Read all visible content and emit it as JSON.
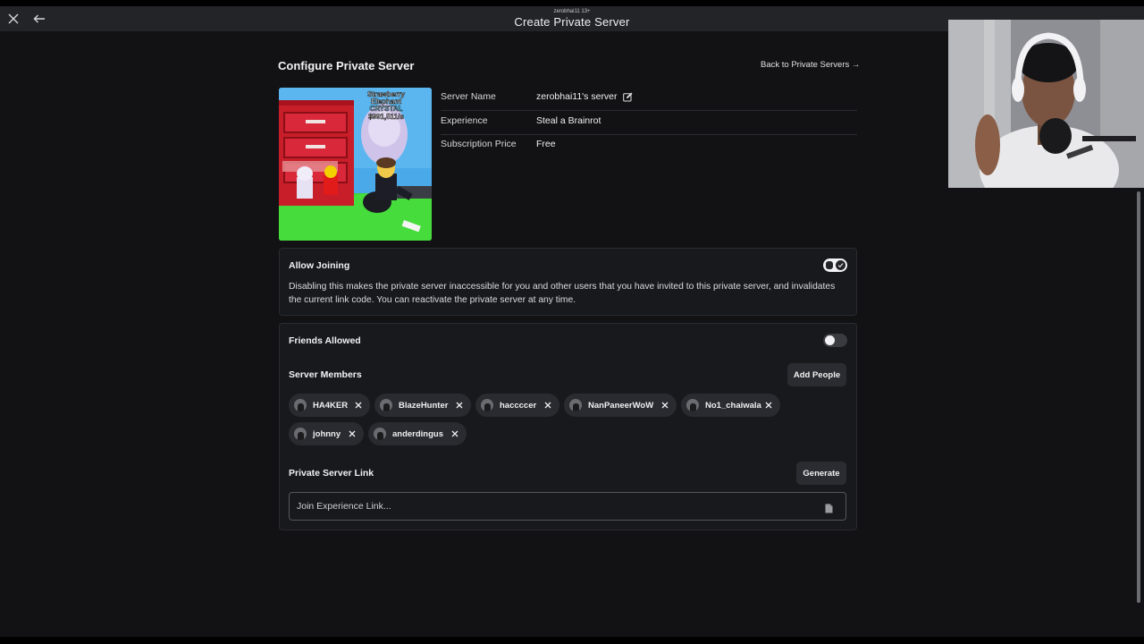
{
  "window": {
    "username": "zerobhai11 13+",
    "title": "Create Private Server"
  },
  "header": {
    "title": "Configure Private Server",
    "back_link": "Back to Private Servers →"
  },
  "details": {
    "server_name_label": "Server Name",
    "server_name_value": "zerobhai11's server",
    "experience_label": "Experience",
    "experience_value": "Steal a Brainrot",
    "price_label": "Subscription Price",
    "price_value": "Free"
  },
  "thumbnail": {
    "text_line1": "Strawberry",
    "text_line2": "Elephant",
    "text_line3": "CRYSTAL",
    "text_line4": "$991,511/s"
  },
  "allow_joining": {
    "label": "Allow Joining",
    "enabled": true,
    "description": "Disabling this makes the private server inaccessible for you and other users that you have invited to this private server, and invalidates the current link code. You can reactivate the private server at any time."
  },
  "friends_allowed": {
    "label": "Friends Allowed",
    "enabled": false
  },
  "members": {
    "label": "Server Members",
    "add_button": "Add People",
    "list": [
      "HA4KER",
      "BlazeHunter",
      "haccccer",
      "NanPaneerWoW",
      "No1_chaiwala",
      "johnny",
      "anderdingus"
    ]
  },
  "link": {
    "label": "Private Server Link",
    "generate_button": "Generate",
    "placeholder": "Join Experience Link..."
  },
  "icons": {
    "close": "close-icon",
    "back": "arrow-left-icon",
    "edit": "edit-icon",
    "remove": "x-icon",
    "copy": "copy-icon",
    "check": "check-icon"
  },
  "colors": {
    "background": "#121214",
    "card": "#18191c",
    "titlebar": "#232427",
    "chip": "#2a2b30"
  }
}
